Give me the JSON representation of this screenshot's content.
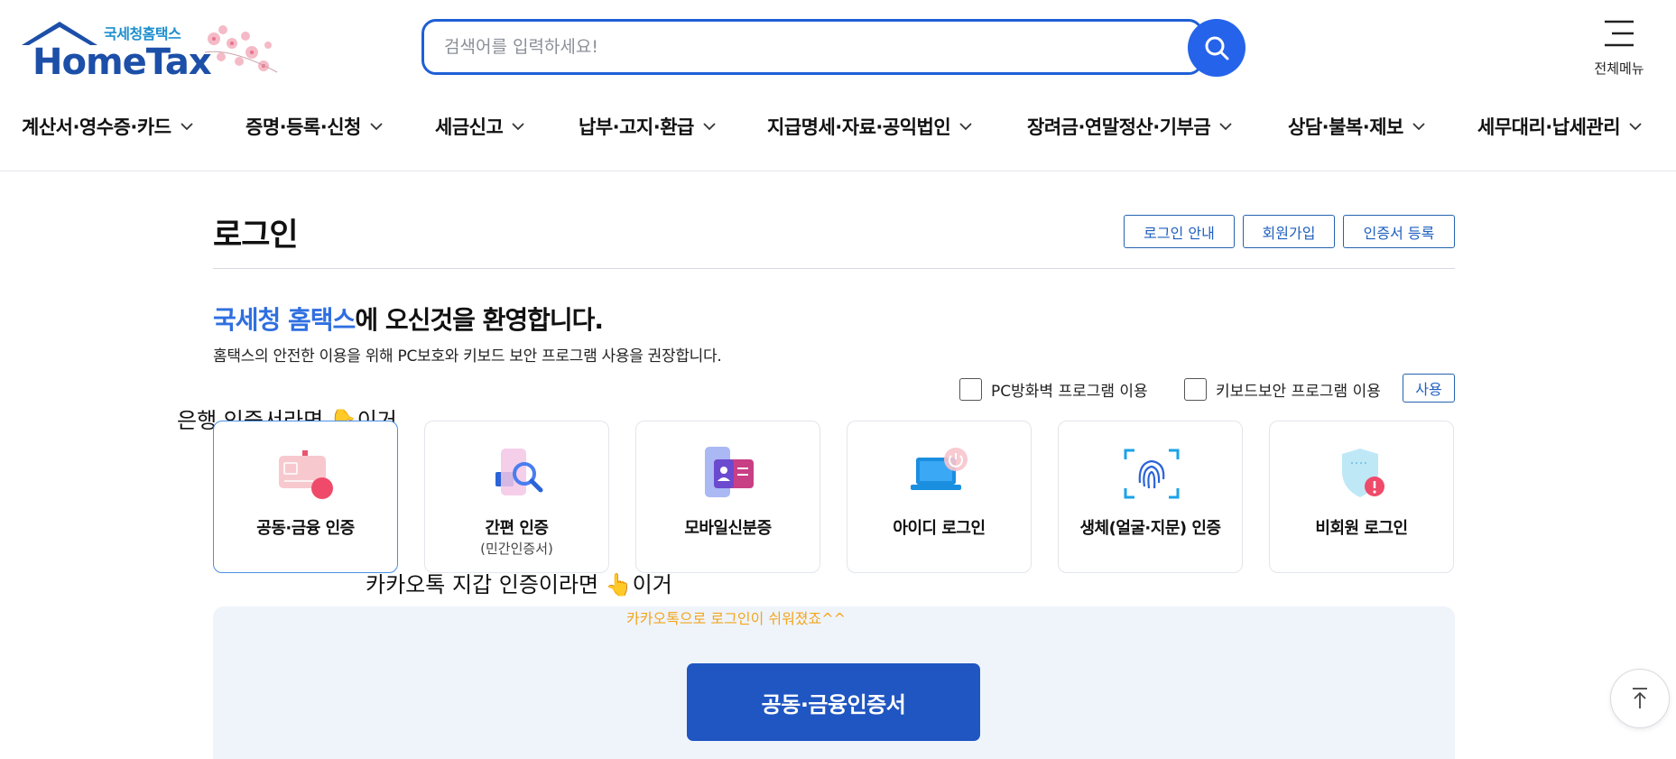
{
  "header": {
    "logo_sub": "국세청홈택스",
    "logo_main": "HomeTax",
    "search_placeholder": "검색어를 입력하세요!",
    "allmenu_label": "전체메뉴"
  },
  "gnb": {
    "items": [
      {
        "label": "계산서·영수증·카드"
      },
      {
        "label": "증명·등록·신청"
      },
      {
        "label": "세금신고"
      },
      {
        "label": "납부·고지·환급"
      },
      {
        "label": "지급명세·자료·공익법인"
      },
      {
        "label": "장려금·연말정산·기부금"
      },
      {
        "label": "상담·불복·제보"
      },
      {
        "label": "세무대리·납세관리"
      }
    ]
  },
  "login": {
    "title": "로그인",
    "buttons": {
      "guide": "로그인 안내",
      "join": "회원가입",
      "cert_register": "인증서 등록"
    },
    "welcome_highlight": "국세청 홈택스",
    "welcome_rest": "에 오신것을 환영합니다.",
    "welcome_sub": "홈택스의 안전한 이용을 위해 PC보호와 키보드 보안 프로그램 사용을 권장합니다.",
    "checkboxes": {
      "firewall": "PC방화벽 프로그램 이용",
      "keyboard": "키보드보안 프로그램 이용"
    },
    "use_button": "사용",
    "methods": [
      {
        "label": "공동·금융 인증",
        "sub": "",
        "icon": "card-cert-icon",
        "selected": true
      },
      {
        "label": "간편 인증",
        "sub": "(민간인증서)",
        "icon": "magnifier-cert-icon",
        "selected": false
      },
      {
        "label": "모바일신분증",
        "sub": "",
        "icon": "mobile-id-icon",
        "selected": false
      },
      {
        "label": "아이디 로그인",
        "sub": "",
        "icon": "laptop-power-icon",
        "selected": false
      },
      {
        "label": "생체(얼굴·지문) 인증",
        "sub": "",
        "icon": "fingerprint-icon",
        "selected": false
      },
      {
        "label": "비회원 로그인",
        "sub": "",
        "icon": "shield-icon",
        "selected": false
      }
    ],
    "tooltip": "카카오톡으로 로그인이 쉬워졌죠^^",
    "main_button": "공동·금융인증서"
  },
  "annotations": {
    "bank": "은행 인증서라면 👇이거",
    "kakao": "카카오톡 지갑 인증이라면 👆이거"
  },
  "colors": {
    "brand_blue": "#1f56c2",
    "accent_blue": "#2f6fe0",
    "tooltip_orange": "#f3a51d",
    "panel_bg": "#eff4fb"
  }
}
